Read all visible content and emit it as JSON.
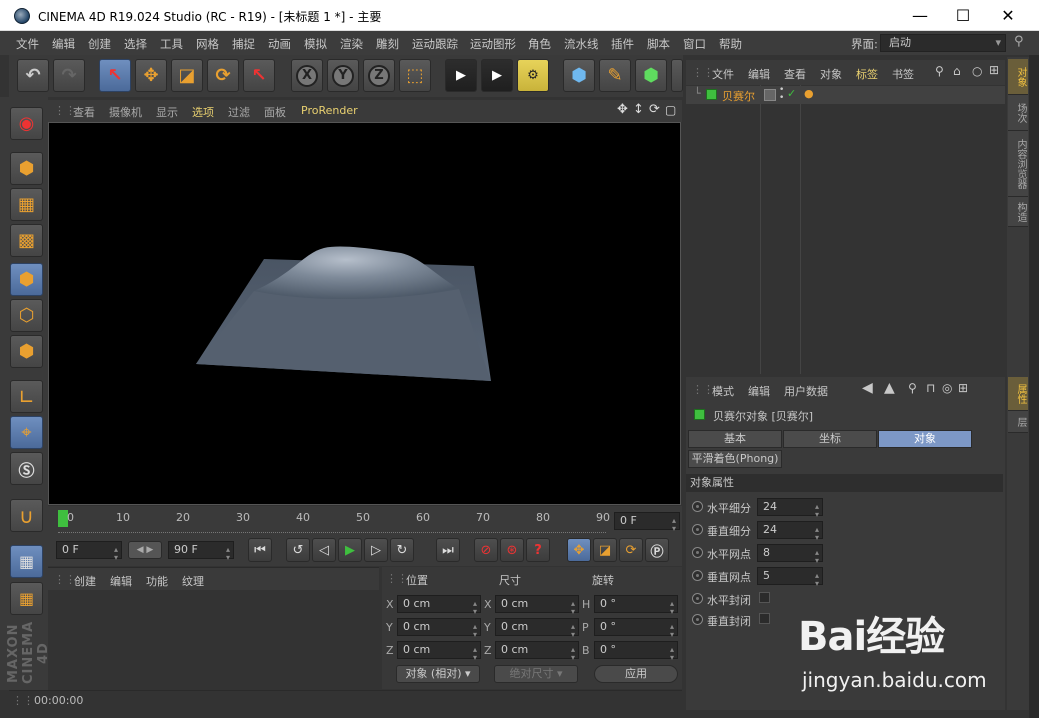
{
  "window": {
    "title": "CINEMA 4D R19.024 Studio (RC - R19) - [未标题 1 *] - 主要",
    "minimize": "—",
    "maximize": "☐",
    "close": "✕"
  },
  "menubar": {
    "items": [
      "文件",
      "编辑",
      "创建",
      "选择",
      "工具",
      "网格",
      "捕捉",
      "动画",
      "模拟",
      "渲染",
      "雕刻",
      "运动跟踪",
      "运动图形",
      "角色",
      "流水线",
      "插件",
      "脚本",
      "窗口",
      "帮助"
    ],
    "layout_label": "界面:",
    "layout_value": "启动"
  },
  "viewport_menu": {
    "items": [
      "查看",
      "摄像机",
      "显示",
      "选项",
      "过滤",
      "面板"
    ],
    "renderer": "ProRender",
    "colors": {
      "highlight": "#e8d070"
    }
  },
  "timeline": {
    "ticks": [
      "0",
      "10",
      "20",
      "30",
      "40",
      "50",
      "60",
      "70",
      "80",
      "90"
    ],
    "current_frame": "0 F"
  },
  "playback": {
    "start_frame": "0 F",
    "end_frame": "90 F"
  },
  "material_panel": {
    "tabs": [
      "创建",
      "编辑",
      "功能",
      "纹理"
    ]
  },
  "coord_panel": {
    "headers": {
      "position": "位置",
      "size": "尺寸",
      "rotation": "旋转"
    },
    "rows": [
      {
        "axis1": "X",
        "pos": "0 cm",
        "axis2": "X",
        "size": "0 cm",
        "axis3": "H",
        "rot": "0 °"
      },
      {
        "axis1": "Y",
        "pos": "0 cm",
        "axis2": "Y",
        "size": "0 cm",
        "axis3": "P",
        "rot": "0 °"
      },
      {
        "axis1": "Z",
        "pos": "0 cm",
        "axis2": "Z",
        "size": "0 cm",
        "axis3": "B",
        "rot": "0 °"
      }
    ],
    "mode": "对象 (相对)",
    "size_mode": "绝对尺寸",
    "apply": "应用"
  },
  "status": {
    "time": "00:00:00"
  },
  "object_manager": {
    "menu": [
      "文件",
      "编辑",
      "查看",
      "对象",
      "标签",
      "书签"
    ],
    "objects": [
      {
        "name": "贝赛尔"
      }
    ]
  },
  "attribute_manager": {
    "menu": [
      "模式",
      "编辑",
      "用户数据"
    ],
    "object_title": "贝赛尔对象 [贝赛尔]",
    "tabs": [
      "基本",
      "坐标",
      "对象"
    ],
    "active_tab": "对象",
    "phong_tab": "平滑着色(Phong)",
    "section": "对象属性",
    "params": [
      {
        "label": "水平细分",
        "value": "24"
      },
      {
        "label": "垂直细分",
        "value": "24"
      },
      {
        "label": "水平网点",
        "value": "8"
      },
      {
        "label": "垂直网点",
        "value": "5"
      },
      {
        "label": "水平封闭",
        "checked": false
      },
      {
        "label": "垂直封闭",
        "checked": false
      }
    ]
  },
  "right_tabs": {
    "top": [
      "对象",
      "场次",
      "内容浏览器",
      "构造"
    ],
    "bottom": [
      "属性",
      "层"
    ]
  },
  "logo": {
    "text": "MAXON CINEMA 4D"
  },
  "watermark": {
    "brand": "Bai经验",
    "url": "jingyan.baidu.com"
  }
}
